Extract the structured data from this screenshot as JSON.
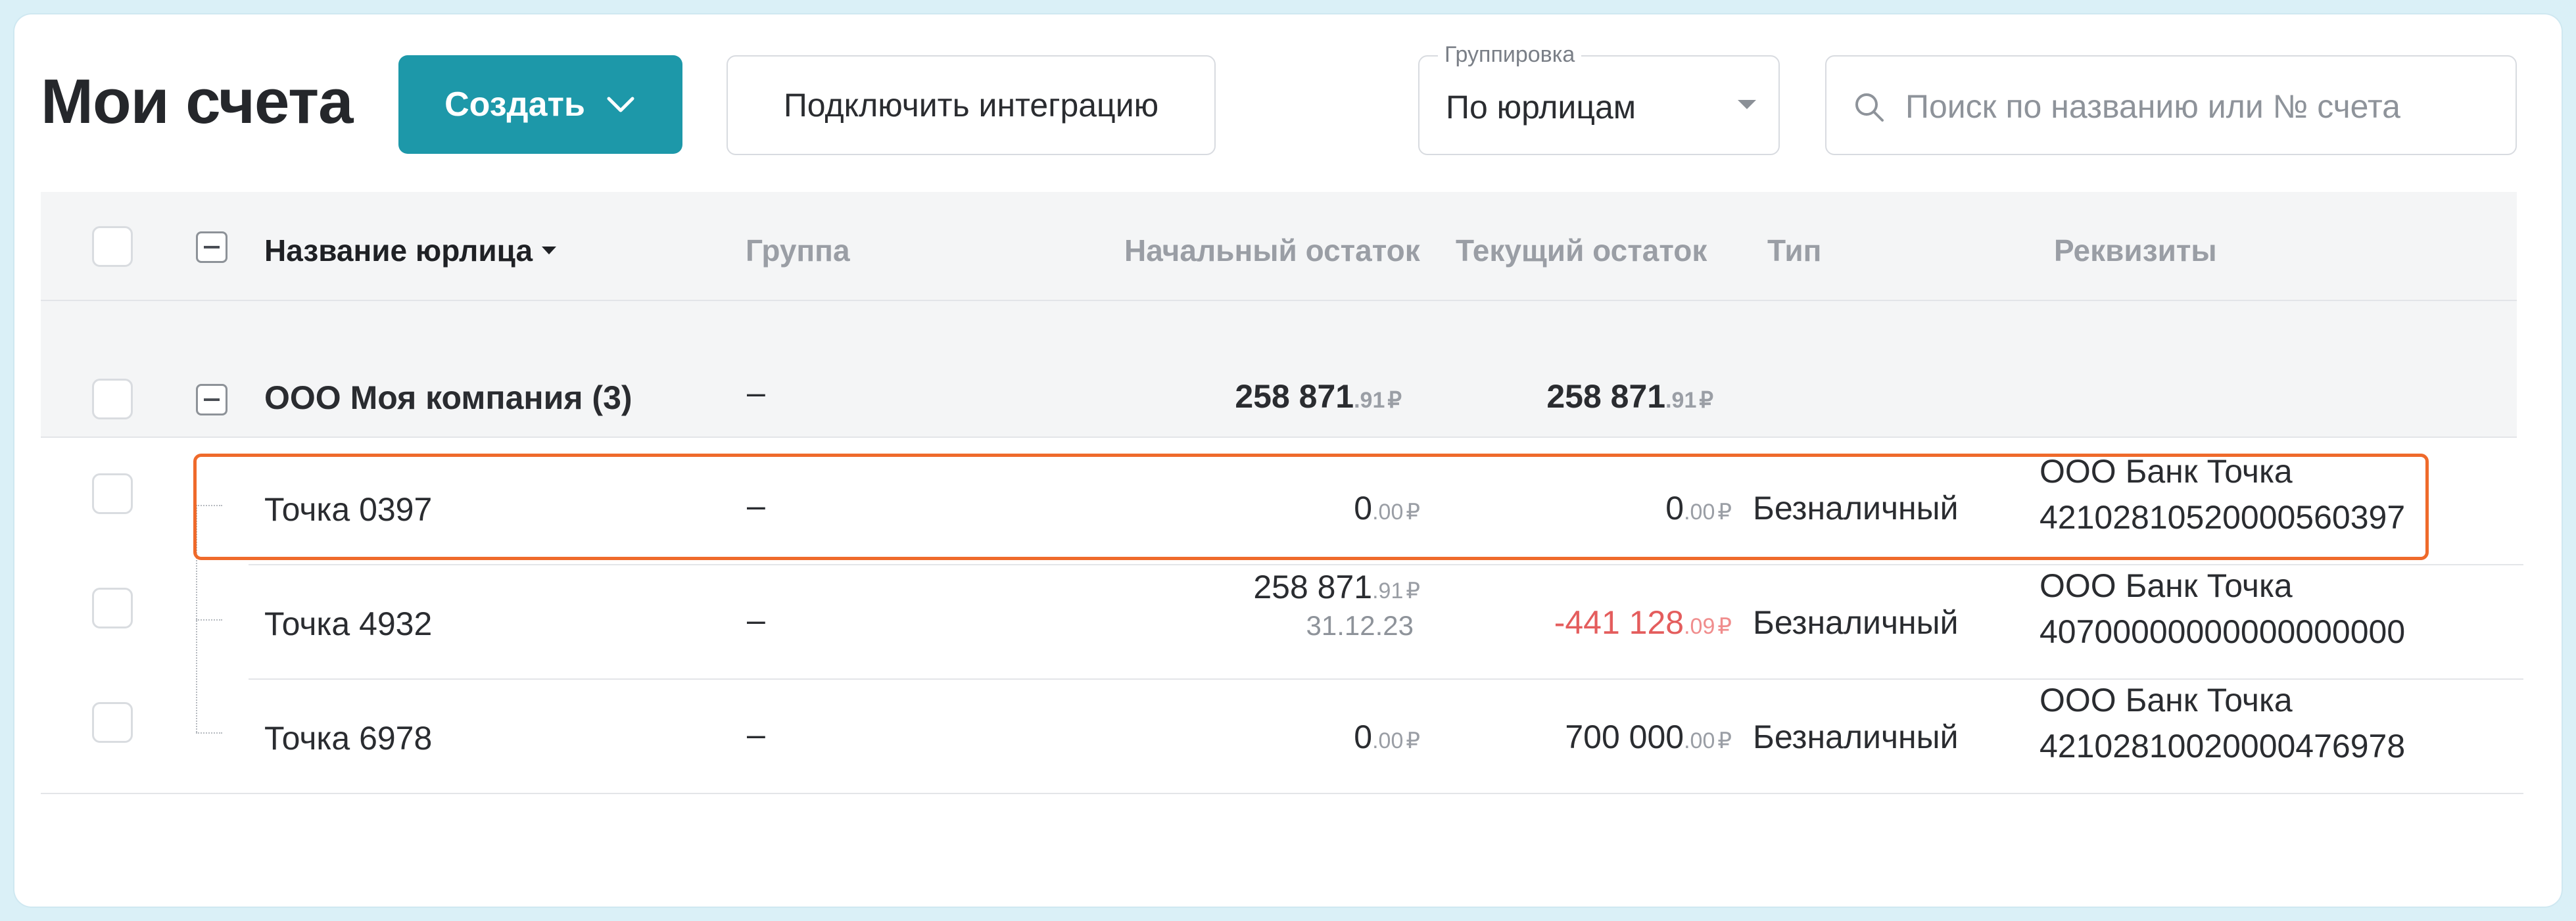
{
  "page": {
    "title": "Мои счета",
    "create_label": "Создать",
    "integration_label": "Подключить интеграцию",
    "grouping": {
      "legend": "Группировка",
      "value": "По юрлицам"
    },
    "search": {
      "placeholder": "Поиск по названию или № счета",
      "value": ""
    }
  },
  "table": {
    "columns": {
      "name": "Название юрлица",
      "group": "Группа",
      "opening": "Начальный остаток",
      "current": "Текущий остаток",
      "type": "Тип",
      "details": "Реквизиты"
    },
    "group_row": {
      "name": "ООО Моя компания (3)",
      "group": "–",
      "opening": {
        "int": "258 871",
        "cents": ".91",
        "cur": "₽"
      },
      "current": {
        "int": "258 871",
        "cents": ".91",
        "cur": "₽"
      }
    },
    "rows": [
      {
        "name": "Точка 0397",
        "group": "–",
        "opening": {
          "int": "0",
          "cents": ".00",
          "cur": "₽"
        },
        "current": {
          "int": "0",
          "cents": ".00",
          "cur": "₽"
        },
        "type": "Безналичный",
        "bank": "ООО Банк Точка",
        "account": "42102810520000560397",
        "highlighted": true
      },
      {
        "name": "Точка 4932",
        "group": "–",
        "opening": {
          "int": "258 871",
          "cents": ".91",
          "cur": "₽",
          "date": "31.12.23"
        },
        "current": {
          "int": "-441 128",
          "cents": ".09",
          "cur": "₽",
          "negative": true
        },
        "type": "Безналичный",
        "bank": "ООО Банк Точка",
        "account": "40700000000000000000"
      },
      {
        "name": "Точка 6978",
        "group": "–",
        "opening": {
          "int": "0",
          "cents": ".00",
          "cur": "₽"
        },
        "current": {
          "int": "700 000",
          "cents": ".00",
          "cur": "₽"
        },
        "type": "Безналичный",
        "bank": "ООО Банк Точка",
        "account": "42102810020000476978"
      }
    ]
  },
  "colors": {
    "accent": "#1d98a9",
    "highlight": "#ef6a2b",
    "negative": "#e45d5d"
  },
  "icons": {
    "create_dropdown": "chevron-down-icon",
    "search": "search-icon",
    "select": "caret-down-icon"
  }
}
